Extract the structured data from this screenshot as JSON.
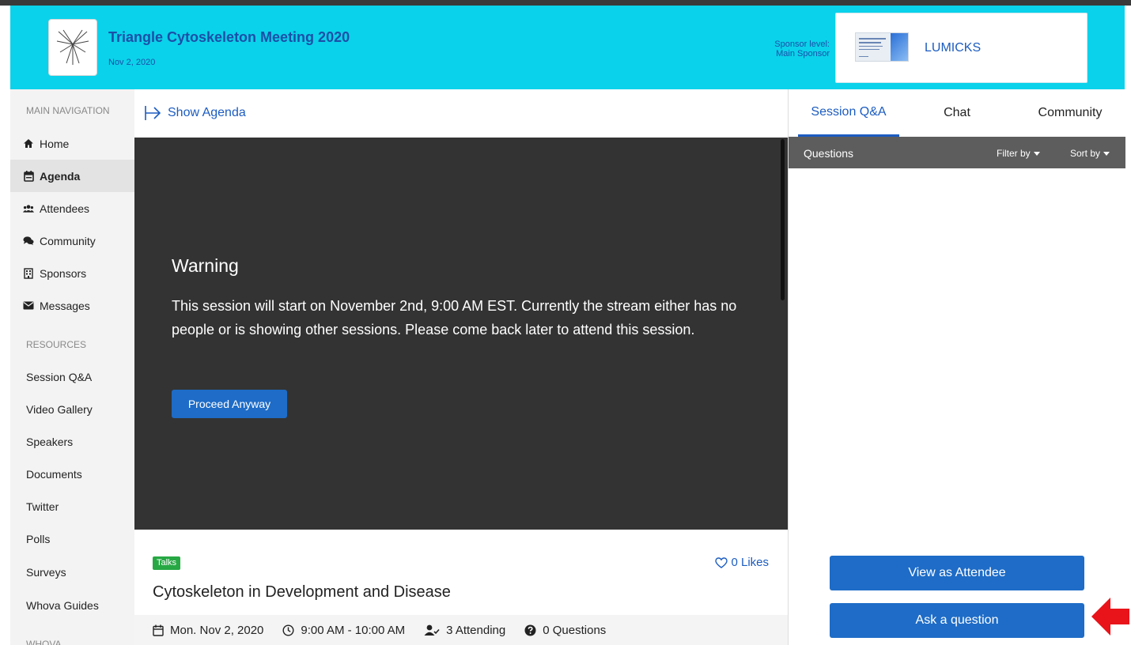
{
  "header": {
    "event_title": "Triangle Cytoskeleton Meeting 2020",
    "event_date": "Nov 2, 2020",
    "sponsor_level_label": "Sponsor level:",
    "sponsor_level_value": "Main Sponsor",
    "sponsor_name": "LUMICKS",
    "background_color": "#0ad2ea"
  },
  "sidebar": {
    "main_heading": "MAIN NAVIGATION",
    "items": [
      {
        "label": "Home",
        "icon": "home-icon"
      },
      {
        "label": "Agenda",
        "icon": "calendar-icon",
        "active": true
      },
      {
        "label": "Attendees",
        "icon": "users-icon"
      },
      {
        "label": "Community",
        "icon": "comments-icon"
      },
      {
        "label": "Sponsors",
        "icon": "building-icon"
      },
      {
        "label": "Messages",
        "icon": "envelope-icon"
      }
    ],
    "resources_heading": "RESOURCES",
    "resources": [
      "Session Q&A",
      "Video Gallery",
      "Speakers",
      "Documents",
      "Twitter",
      "Polls",
      "Surveys",
      "Whova Guides"
    ],
    "whova_heading": "WHOVA"
  },
  "main": {
    "show_agenda": "Show Agenda",
    "warning_title": "Warning",
    "warning_text": "This session will start on November 2nd, 9:00 AM EST. Currently the stream either has no people or is showing other sessions. Please come back later to attend this session.",
    "proceed_button": "Proceed Anyway",
    "tag": "Talks",
    "likes": "0 Likes",
    "session_title": "Cytoskeleton in Development and Disease",
    "date": "Mon. Nov 2, 2020",
    "time": "9:00 AM - 10:00 AM",
    "attending": "3 Attending",
    "questions": "0 Questions"
  },
  "right_panel": {
    "tabs": [
      "Session Q&A",
      "Chat",
      "Community"
    ],
    "active_tab": "Session Q&A",
    "questions_label": "Questions",
    "filter_label": "Filter by",
    "sort_label": "Sort by",
    "view_as_attendee": "View as Attendee",
    "ask_question": "Ask a question"
  },
  "colors": {
    "accent_blue": "#1e6cc7",
    "tag_green": "#27a844",
    "annotation_red": "#e8141a"
  }
}
